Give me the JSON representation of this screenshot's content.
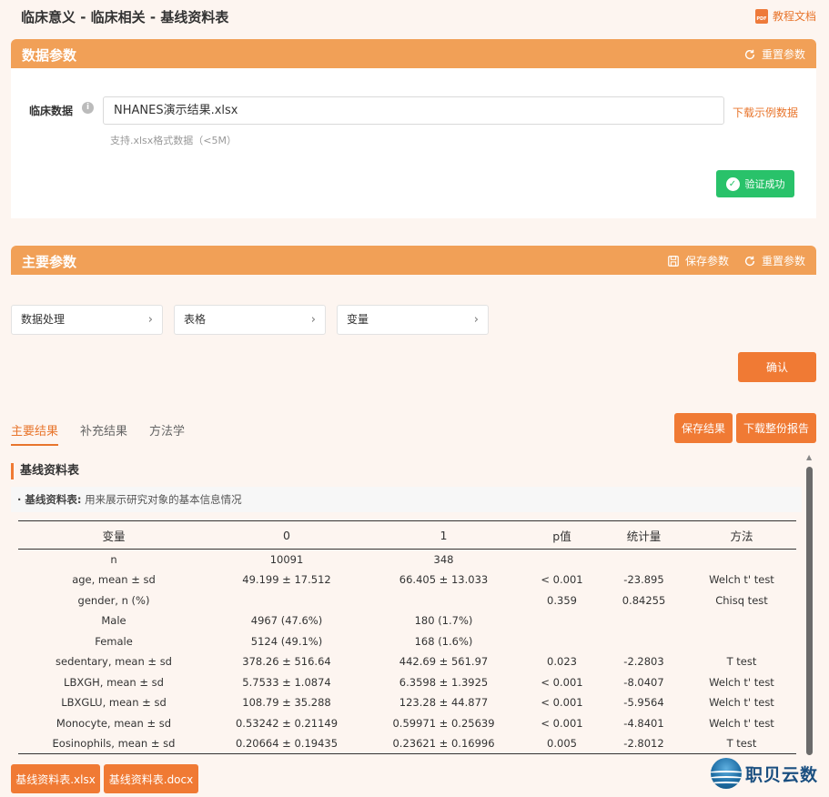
{
  "header": {
    "title": "临床意义 - 临床相关 - 基线资料表",
    "doc_link": "教程文档",
    "pdf_icon_text": "PDF"
  },
  "data_params": {
    "title": "数据参数",
    "reset": "重置参数",
    "field_label": "临床数据",
    "info_icon": "i",
    "file_value": "NHANES演示结果.xlsx",
    "download_sample": "下载示例数据",
    "hint": "支持.xlsx格式数据（<5M）",
    "verify_button": "验证成功"
  },
  "main_params": {
    "title": "主要参数",
    "save": "保存参数",
    "reset": "重置参数",
    "selectors": [
      "数据处理",
      "表格",
      "变量"
    ],
    "confirm": "确认"
  },
  "results": {
    "tabs": [
      "主要结果",
      "补充结果",
      "方法学"
    ],
    "save_results": "保存结果",
    "download_report": "下载整份报告",
    "section_title": "基线资料表",
    "desc_prefix": "· 基线资料表:",
    "desc_text": " 用来展示研究对象的基本信息情况",
    "table": {
      "headers": [
        "变量",
        "0",
        "1",
        "p值",
        "统计量",
        "方法"
      ],
      "rows": [
        [
          "n",
          "10091",
          "348",
          "",
          "",
          ""
        ],
        [
          "age, mean ± sd",
          "49.199 ± 17.512",
          "66.405 ± 13.033",
          "< 0.001",
          "-23.895",
          "Welch t' test"
        ],
        [
          "gender, n (%)",
          "",
          "",
          "0.359",
          "0.84255",
          "Chisq test"
        ],
        [
          "Male",
          "4967 (47.6%)",
          "180 (1.7%)",
          "",
          "",
          ""
        ],
        [
          "Female",
          "5124 (49.1%)",
          "168 (1.6%)",
          "",
          "",
          ""
        ],
        [
          "sedentary, mean ± sd",
          "378.26 ± 516.64",
          "442.69 ± 561.97",
          "0.023",
          "-2.2803",
          "T test"
        ],
        [
          "LBXGH, mean ± sd",
          "5.7533 ± 1.0874",
          "6.3598 ± 1.3925",
          "< 0.001",
          "-8.0407",
          "Welch t' test"
        ],
        [
          "LBXGLU, mean ± sd",
          "108.79 ± 35.288",
          "123.28 ± 44.877",
          "< 0.001",
          "-5.9564",
          "Welch t' test"
        ],
        [
          "Monocyte, mean ± sd",
          "0.53242 ± 0.21149",
          "0.59971 ± 0.25639",
          "< 0.001",
          "-4.8401",
          "Welch t' test"
        ],
        [
          "Eosinophils, mean ± sd",
          "0.20664 ± 0.19435",
          "0.23621 ± 0.16996",
          "0.005",
          "-2.8012",
          "T test"
        ]
      ]
    },
    "download_xlsx": "基线资料表.xlsx",
    "download_docx": "基线资料表.docx"
  },
  "brand": {
    "name": "职贝云数"
  },
  "colors": {
    "accent": "#f07a34",
    "panel_header": "#f1a057",
    "success": "#29c26a"
  }
}
